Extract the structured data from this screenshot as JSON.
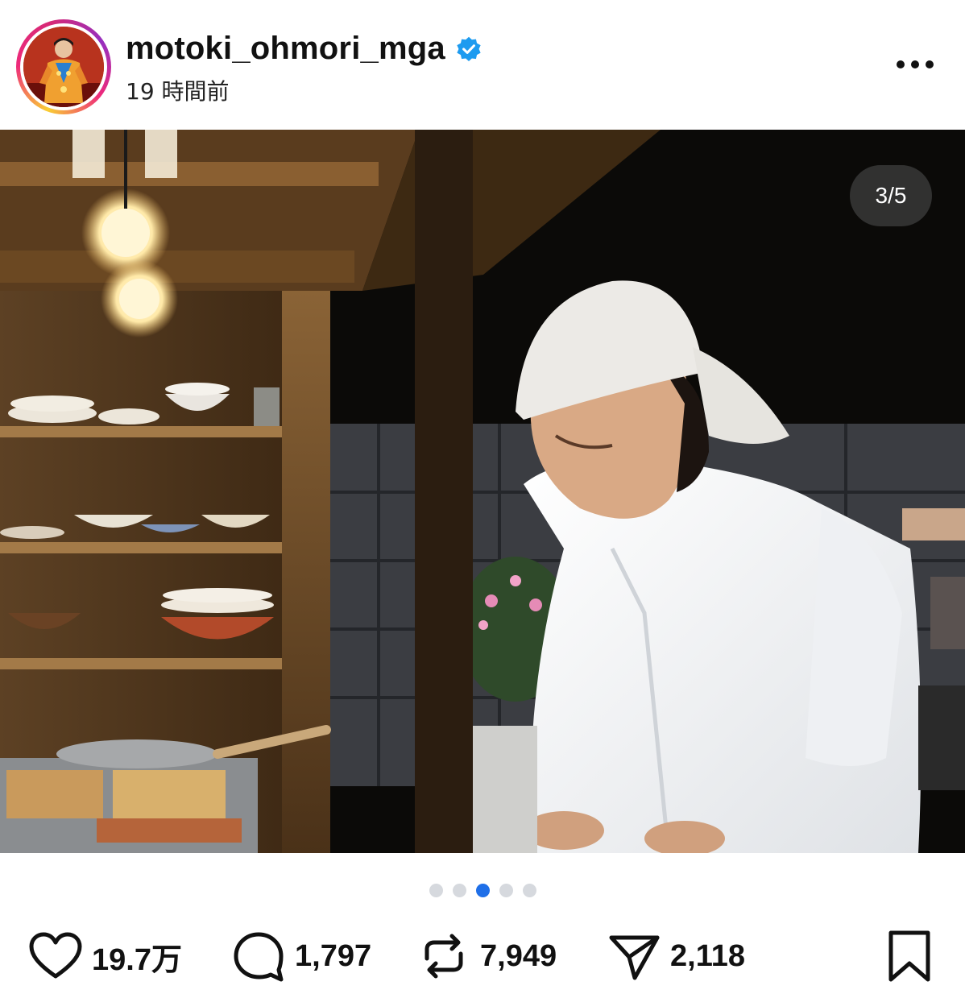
{
  "header": {
    "username": "motoki_ohmori_mga",
    "verified": true,
    "timestamp": "19 時間前",
    "more_icon": "more-horizontal-icon"
  },
  "media": {
    "counter": "3/5",
    "description_alt": ""
  },
  "carousel": {
    "total": 5,
    "active_index": 2
  },
  "actions": {
    "likes": {
      "icon": "heart-icon",
      "count": "19.7万"
    },
    "comments": {
      "icon": "comment-icon",
      "count": "1,797"
    },
    "reposts": {
      "icon": "repost-icon",
      "count": "7,949"
    },
    "shares": {
      "icon": "send-icon",
      "count": "2,118"
    },
    "save": {
      "icon": "bookmark-icon"
    }
  },
  "colors": {
    "verified_blue": "#1d9bf0",
    "active_dot": "#1f6fe8",
    "inactive_dot": "#d6d9de"
  }
}
